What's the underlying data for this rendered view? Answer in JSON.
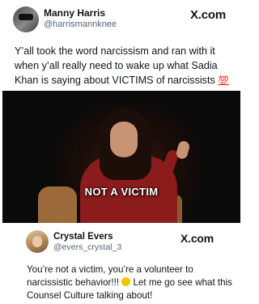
{
  "post1": {
    "name": "Manny Harris",
    "handle": "@harrismannknee",
    "brand": "X.com",
    "text": "Y’all took the word narcissism and ran with it when y’all really need to wake up what Sadia Khan is saying about VICTIMS of narcissists",
    "emoji": "💯"
  },
  "video": {
    "caption": "NOT A VICTIM"
  },
  "post2": {
    "name": "Crystal Evers",
    "handle": "@evers_crystal_3",
    "brand": "X.com",
    "text_before_emoji": "You’re not a victim, you’re a volunteer to narcissistic behavior!!! ",
    "text_after_emoji": " Let me go see what this Counsel Culture talking about!"
  }
}
